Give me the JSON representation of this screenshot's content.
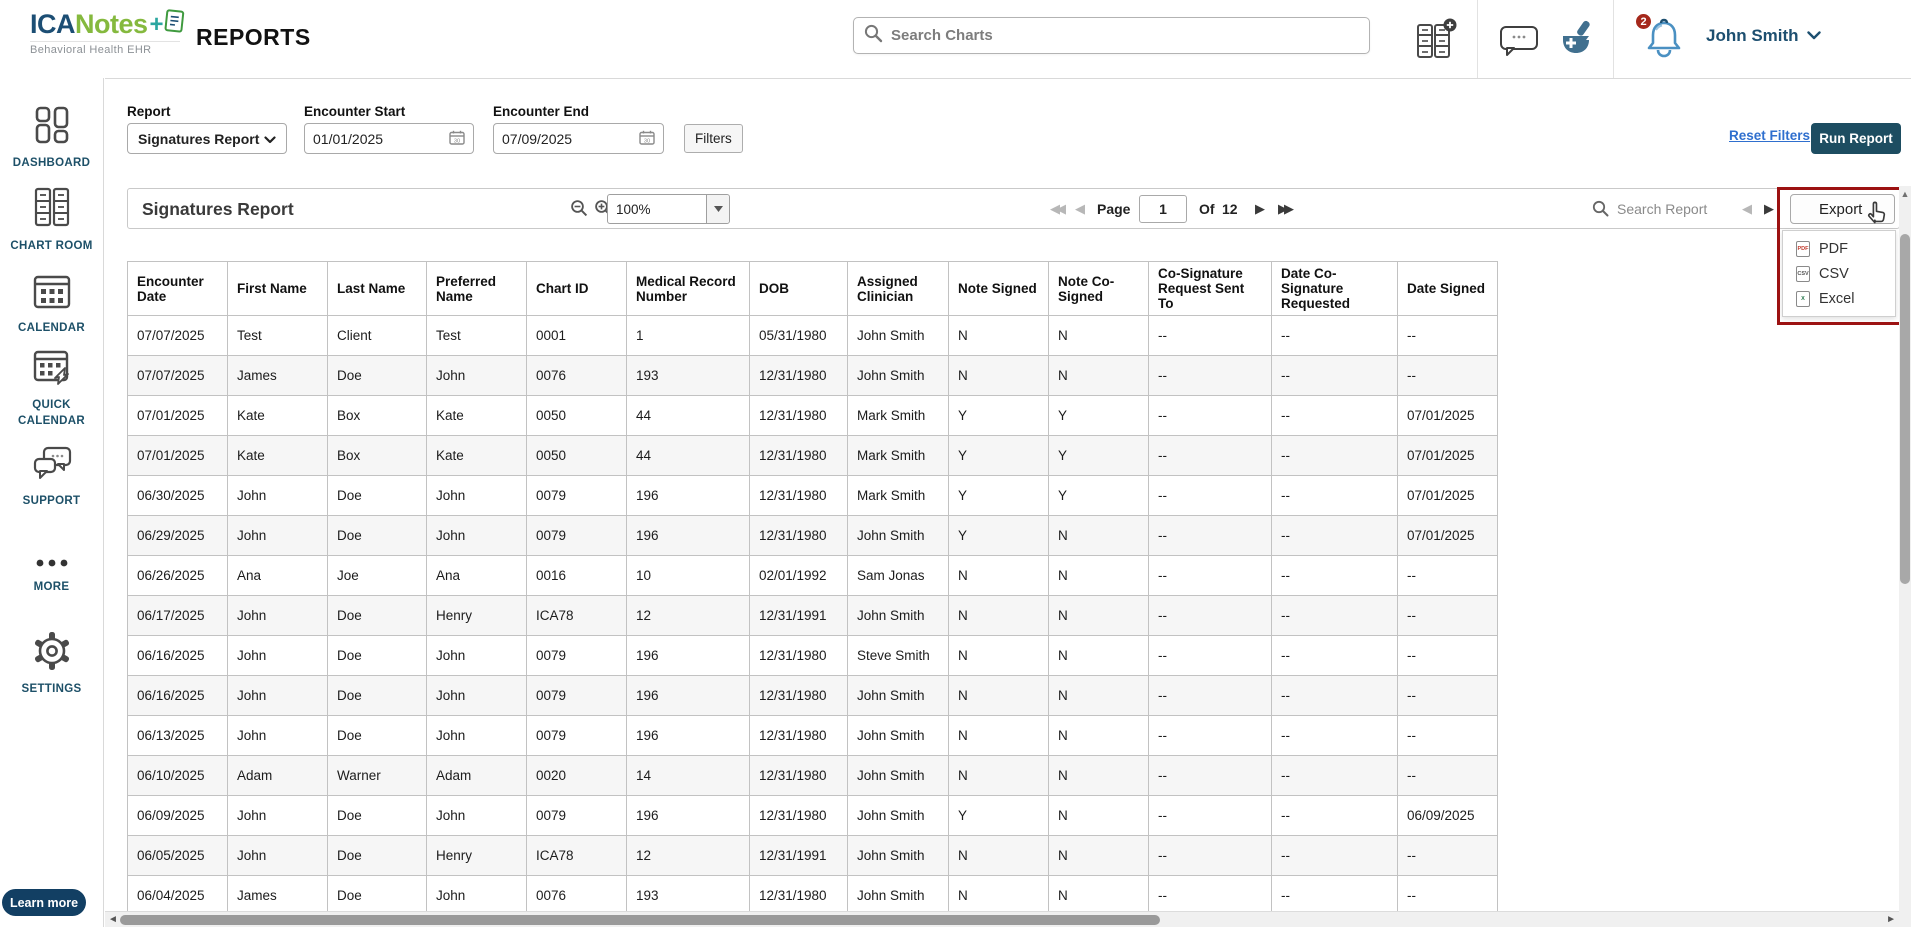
{
  "header": {
    "logo": {
      "ica": "ICA",
      "notes": "Notes",
      "tagline": "Behavioral Health EHR"
    },
    "page_title": "REPORTS",
    "search_placeholder": "Search Charts",
    "notification_count": "2",
    "user_name": "John Smith"
  },
  "sidebar": {
    "items": [
      {
        "label": "DASHBOARD"
      },
      {
        "label": "CHART ROOM"
      },
      {
        "label": "CALENDAR"
      },
      {
        "label": "QUICK CALENDAR"
      },
      {
        "label": "SUPPORT"
      },
      {
        "label": "MORE"
      },
      {
        "label": "SETTINGS"
      }
    ],
    "learn_more": "Learn more"
  },
  "filters": {
    "report_label": "Report",
    "report_value": "Signatures Report",
    "encounter_start_label": "Encounter Start",
    "encounter_start_value": "01/01/2025",
    "encounter_end_label": "Encounter End",
    "encounter_end_value": "07/09/2025",
    "filters_button": "Filters",
    "reset_filters": "Reset Filters",
    "run_report": "Run Report"
  },
  "report": {
    "title": "Signatures Report",
    "zoom_value": "100%",
    "pager": {
      "page_label": "Page",
      "page_value": "1",
      "of_label": "Of",
      "total_pages": "12"
    },
    "search_placeholder": "Search Report",
    "export_label": "Export",
    "export_menu": [
      {
        "label": "PDF",
        "icon_text": "PDF"
      },
      {
        "label": "CSV",
        "icon_text": "CSV"
      },
      {
        "label": "Excel",
        "icon_text": "X"
      }
    ]
  },
  "table": {
    "columns": [
      "Encounter Date",
      "First Name",
      "Last Name",
      "Preferred Name",
      "Chart ID",
      "Medical Record Number",
      "DOB",
      "Assigned Clinician",
      "Note Signed",
      "Note Co-Signed",
      "Co-Signature Request Sent To",
      "Date Co-Signature Requested",
      "Date Signed"
    ],
    "rows": [
      [
        "07/07/2025",
        "Test",
        "Client",
        "Test",
        "0001",
        "1",
        "05/31/1980",
        "John Smith",
        "N",
        "N",
        "--",
        "--",
        "--"
      ],
      [
        "07/07/2025",
        "James",
        "Doe",
        "John",
        "0076",
        "193",
        "12/31/1980",
        "John Smith",
        "N",
        "N",
        "--",
        "--",
        "--"
      ],
      [
        "07/01/2025",
        "Kate",
        "Box",
        "Kate",
        "0050",
        "44",
        "12/31/1980",
        "Mark Smith",
        "Y",
        "Y",
        "--",
        "--",
        "07/01/2025"
      ],
      [
        "07/01/2025",
        "Kate",
        "Box",
        "Kate",
        "0050",
        "44",
        "12/31/1980",
        "Mark Smith",
        "Y",
        "Y",
        "--",
        "--",
        "07/01/2025"
      ],
      [
        "06/30/2025",
        "John",
        "Doe",
        "John",
        "0079",
        "196",
        "12/31/1980",
        "Mark Smith",
        "Y",
        "Y",
        "--",
        "--",
        "07/01/2025"
      ],
      [
        "06/29/2025",
        "John",
        "Doe",
        "John",
        "0079",
        "196",
        "12/31/1980",
        "John Smith",
        "Y",
        "N",
        "--",
        "--",
        "07/01/2025"
      ],
      [
        "06/26/2025",
        "Ana",
        "Joe",
        "Ana",
        "0016",
        "10",
        "02/01/1992",
        "Sam Jonas",
        "N",
        "N",
        "--",
        "--",
        "--"
      ],
      [
        "06/17/2025",
        "John",
        "Doe",
        "Henry",
        "ICA78",
        "12",
        "12/31/1991",
        "John Smith",
        "N",
        "N",
        "--",
        "--",
        "--"
      ],
      [
        "06/16/2025",
        "John",
        "Doe",
        "John",
        "0079",
        "196",
        "12/31/1980",
        "Steve Smith",
        "N",
        "N",
        "--",
        "--",
        "--"
      ],
      [
        "06/16/2025",
        "John",
        "Doe",
        "John",
        "0079",
        "196",
        "12/31/1980",
        "John Smith",
        "N",
        "N",
        "--",
        "--",
        "--"
      ],
      [
        "06/13/2025",
        "John",
        "Doe",
        "John",
        "0079",
        "196",
        "12/31/1980",
        "John Smith",
        "N",
        "N",
        "--",
        "--",
        "--"
      ],
      [
        "06/10/2025",
        "Adam",
        "Warner",
        "Adam",
        "0020",
        "14",
        "12/31/1980",
        "John Smith",
        "N",
        "N",
        "--",
        "--",
        "--"
      ],
      [
        "06/09/2025",
        "John",
        "Doe",
        "John",
        "0079",
        "196",
        "12/31/1980",
        "John Smith",
        "Y",
        "N",
        "--",
        "--",
        "06/09/2025"
      ],
      [
        "06/05/2025",
        "John",
        "Doe",
        "Henry",
        "ICA78",
        "12",
        "12/31/1991",
        "John Smith",
        "N",
        "N",
        "--",
        "--",
        "--"
      ],
      [
        "06/04/2025",
        "James",
        "Doe",
        "John",
        "0076",
        "193",
        "12/31/1980",
        "John Smith",
        "N",
        "N",
        "--",
        "--",
        "--"
      ]
    ]
  },
  "colors": {
    "brand_navy": "#1d5068",
    "brand_green": "#85b93e",
    "run_report_button": "#1d4d61",
    "link_blue": "#2f6fce",
    "highlight_red": "#9c1212",
    "badge_red": "#a5281b",
    "bell_blue": "#4a90c2"
  }
}
